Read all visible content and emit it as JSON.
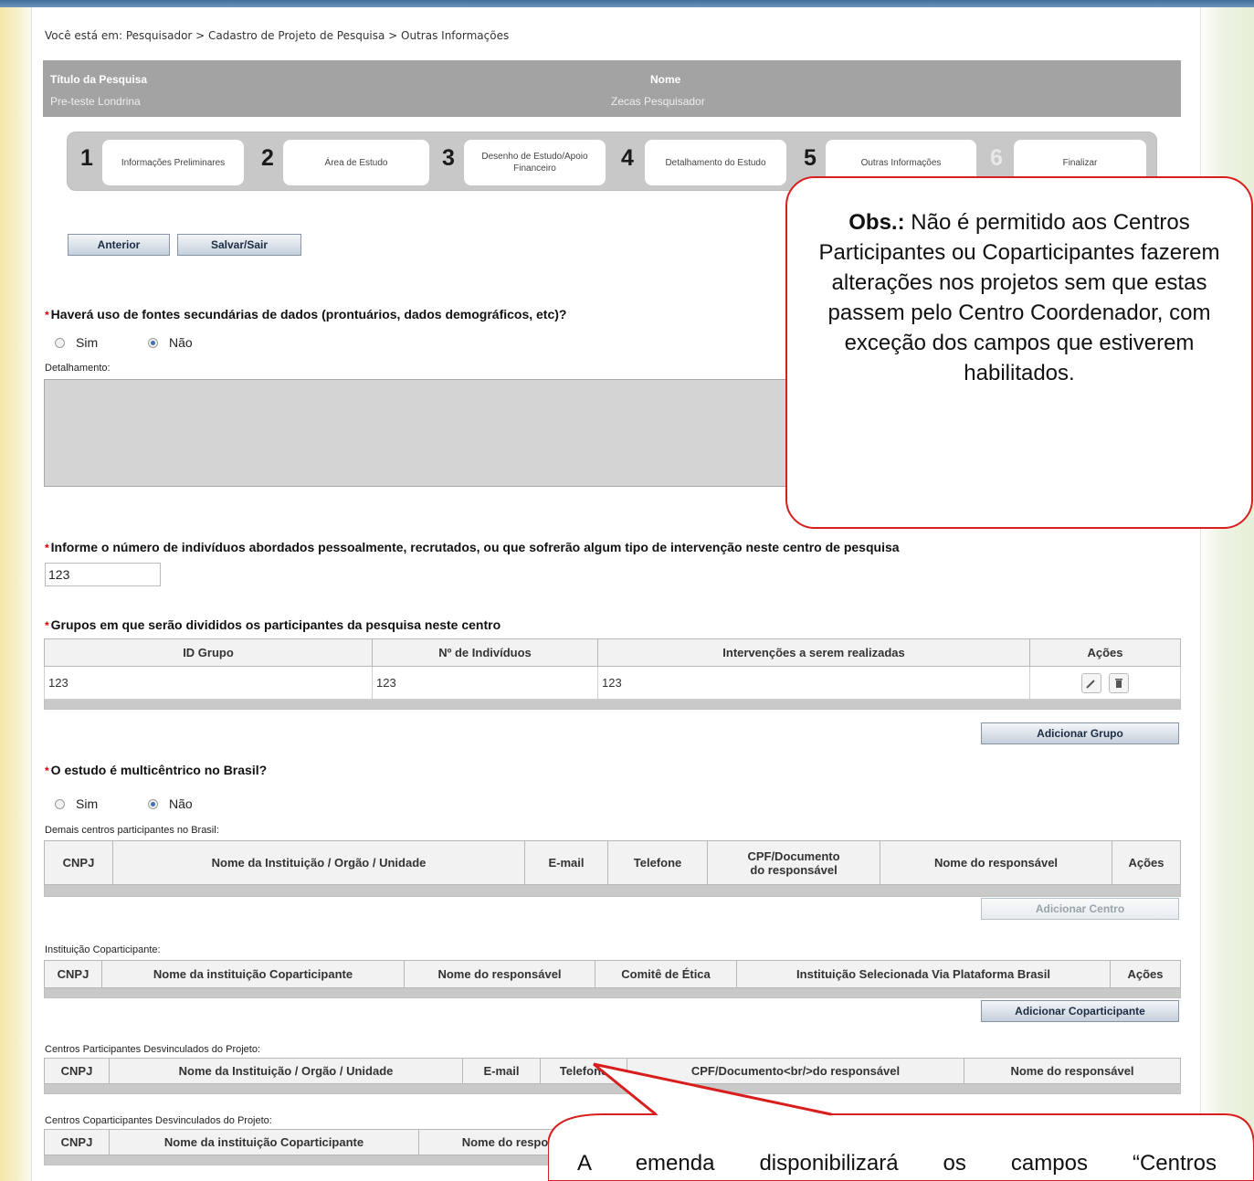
{
  "breadcrumb": "Você está em: Pesquisador > Cadastro de Projeto de Pesquisa > Outras Informações",
  "info": {
    "title_label": "Título da Pesquisa",
    "title_value": "Pre-teste Londrina",
    "name_label": "Nome",
    "name_value": "Zecas Pesquisador"
  },
  "steps": [
    {
      "num": "1",
      "label": "Informações Preliminares"
    },
    {
      "num": "2",
      "label": "Área de Estudo"
    },
    {
      "num": "3",
      "label": "Desenho de Estudo/Apoio Financeiro"
    },
    {
      "num": "4",
      "label": "Detalhamento do Estudo"
    },
    {
      "num": "5",
      "label": "Outras Informações"
    },
    {
      "num": "6",
      "label": "Finalizar"
    }
  ],
  "buttons": {
    "anterior": "Anterior",
    "salvar": "Salvar/Sair",
    "add_grupo": "Adicionar Grupo",
    "add_centro": "Adicionar Centro",
    "add_coparticipante": "Adicionar Coparticipante"
  },
  "q1": {
    "label": "Haverá uso de fontes secundárias de dados (prontuários, dados demográficos, etc)?",
    "sim": "Sim",
    "nao": "Não",
    "selected": "nao",
    "detail_label": "Detalhamento:"
  },
  "q2": {
    "label": "Informe o número de indivíduos abordados pessoalmente, recrutados, ou que sofrerão algum tipo de intervenção neste centro de pesquisa",
    "value": "123"
  },
  "q3": {
    "label": "Grupos em que serão divididos os participantes da pesquisa neste centro",
    "headers": [
      "ID Grupo",
      "Nº de Indivíduos",
      "Intervenções a serem realizadas",
      "Ações"
    ],
    "rows": [
      [
        "123",
        "123",
        "123"
      ]
    ]
  },
  "q4": {
    "label": "O estudo é multicêntrico no Brasil?",
    "sim": "Sim",
    "nao": "Não",
    "selected": "nao"
  },
  "centros": {
    "label": "Demais centros participantes no Brasil:",
    "headers": [
      "CNPJ",
      "Nome da Instituição / Orgão / Unidade",
      "E-mail",
      "Telefone",
      "CPF/Documento",
      "do responsável",
      "Nome do responsável",
      "Ações"
    ]
  },
  "coparticipante": {
    "label": "Instituição Coparticipante:",
    "headers": [
      "CNPJ",
      "Nome da instituição Coparticipante",
      "Nome do responsável",
      "Comitê de Ética",
      "Instituição Selecionada Via Plataforma Brasil",
      "Ações"
    ]
  },
  "desvinculados": {
    "label": "Centros Participantes Desvinculados do Projeto:",
    "headers": [
      "CNPJ",
      "Nome da Instituição / Orgão / Unidade",
      "E-mail",
      "Telefone",
      "CPF/Documento<br/>do responsável",
      "Nome do responsável"
    ]
  },
  "copart_desvinculados": {
    "label": "Centros Coparticipantes Desvinculados do Projeto:",
    "headers": [
      "CNPJ",
      "Nome da instituição Coparticipante",
      "Nome do respo"
    ]
  },
  "callout1": {
    "bold": "Obs.:",
    "text": "Não é permitido aos Centros Participantes ou Coparticipantes fazerem alterações nos projetos sem que estas passem pelo Centro Coordenador, com exceção dos campos que estiverem habilitados."
  },
  "callout2": {
    "text": "A emenda disponibilizará os campos “Centros"
  },
  "colors": {
    "accent": "#d91e1e",
    "infobar": "#a3a3a3",
    "button": "#c4cfdc"
  }
}
